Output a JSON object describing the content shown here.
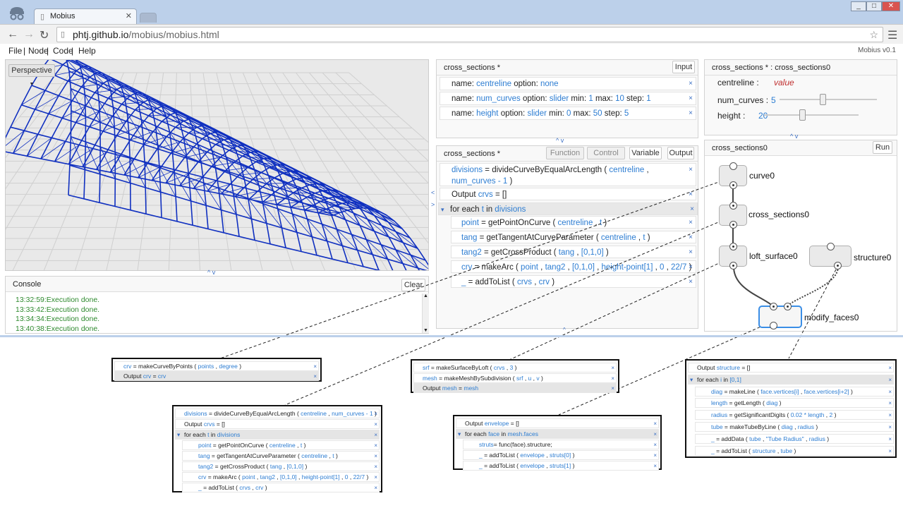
{
  "browser": {
    "tab_title": "Mobius",
    "url_host": "phtj.github.io",
    "url_path": "/mobius/mobius.html"
  },
  "menu": {
    "items": [
      "File",
      "Node",
      "Code",
      "Help"
    ],
    "separator": " | ",
    "version": "Mobius v0.1"
  },
  "viewport": {
    "camera_label": "Perspective"
  },
  "console": {
    "title": "Console",
    "clear_label": "Clear",
    "lines": [
      "13:32:59:Execution done.",
      "13:33:42:Execution done.",
      "13:34:34:Execution done.",
      "13:40:38:Execution done."
    ]
  },
  "input_panel": {
    "title": "cross_sections *",
    "button": "Input",
    "rows": [
      {
        "parts": [
          "name: ",
          "centreline",
          "  option: ",
          "none"
        ]
      },
      {
        "parts": [
          "name: ",
          "num_curves",
          "  option: ",
          "slider",
          "  min: ",
          "1",
          "  max: ",
          "10",
          "  step: ",
          "1"
        ]
      },
      {
        "parts": [
          "name: ",
          "height",
          "  option: ",
          "slider",
          "  min: ",
          "0",
          "  max: ",
          "50",
          "  step: ",
          "5"
        ]
      }
    ]
  },
  "code_panel": {
    "title": "cross_sections *",
    "buttons": [
      "Function",
      "Control",
      "Variable",
      "Output"
    ],
    "rows": [
      {
        "text": [
          "divisions",
          " = divideCurveByEqualArcLength ( ",
          "centreline",
          " ,"
        ]
      },
      {
        "text": [
          "num_curves - 1",
          "   )"
        ]
      },
      {
        "text": [
          "Output ",
          "crvs",
          " = []"
        ]
      },
      {
        "text": [
          "for each ",
          "t",
          " in ",
          "divisions"
        ]
      },
      {
        "text": [
          "point",
          " = getPointOnCurve ( ",
          "centreline",
          " , ",
          "t",
          "   )"
        ]
      },
      {
        "text": [
          "tang",
          " = getTangentAtCurveParameter ( ",
          "centreline",
          " , ",
          "t",
          "   )"
        ]
      },
      {
        "text": [
          "tang2",
          " = getCrossProduct ( ",
          "tang",
          " , ",
          "[0,1,0]",
          "   )"
        ]
      },
      {
        "text": [
          "crv",
          " = makeArc ( ",
          "point",
          " , ",
          "tang2",
          " , ",
          "[0,1,0]",
          " , ",
          "height-point[1]",
          " , ",
          "0",
          " , ",
          "22/7",
          "   )"
        ]
      },
      {
        "text": [
          "_",
          " = addToList ( ",
          "crvs",
          " , ",
          "crv",
          "   )"
        ]
      }
    ]
  },
  "params_panel": {
    "title": "cross_sections * :  cross_sections0",
    "centreline_label": "centreline  :",
    "centreline_value": "value",
    "num_curves_label": "num_curves  :",
    "num_curves_value": "5",
    "num_curves_fraction": 0.44,
    "height_label": "height  :",
    "height_value": "20",
    "height_fraction": 0.4
  },
  "graph_panel": {
    "title": "cross_sections0",
    "run_label": "Run",
    "nodes": [
      "curve0",
      "cross_sections0",
      "loft_surface0",
      "structure0",
      "modify_faces0"
    ]
  },
  "popups": {
    "p1": [
      [
        "crv",
        " = makeCurveByPoints ( ",
        "points",
        " , ",
        "degree",
        "   )"
      ],
      [
        "Output ",
        "crv",
        " = ",
        "crv"
      ]
    ],
    "p2": [
      [
        "divisions",
        " = divideCurveByEqualArcLength ( ",
        "centreline",
        " , ",
        "num_curves - 1",
        "   )"
      ],
      [
        "Output ",
        "crvs",
        " = []"
      ],
      [
        "for each ",
        "t",
        " in ",
        "divisions"
      ],
      [
        "point",
        " = getPointOnCurve ( ",
        "centreline",
        " , ",
        "t",
        "   )"
      ],
      [
        "tang",
        " = getTangentAtCurveParameter ( ",
        "centreline",
        " , ",
        "t",
        "   )"
      ],
      [
        "tang2",
        " = getCrossProduct ( ",
        "tang",
        " , ",
        "[0,1,0]",
        "   )"
      ],
      [
        "crv",
        " = makeArc ( ",
        "point",
        " , ",
        "tang2",
        " , ",
        "[0,1,0]",
        " , ",
        "height-point[1]",
        " , ",
        "0",
        " , ",
        "22/7",
        "   )"
      ],
      [
        "_",
        " = addToList ( ",
        "crvs",
        " , ",
        "crv",
        "   )"
      ]
    ],
    "p3": [
      [
        "srf",
        " = makeSurfaceByLoft ( ",
        "crvs",
        " , ",
        "3",
        "   )"
      ],
      [
        "mesh",
        " = makeMeshBySubdivision ( ",
        "srf",
        " , ",
        "u",
        " , ",
        "v",
        "   )"
      ],
      [
        "Output ",
        "mesh",
        " = ",
        "mesh"
      ]
    ],
    "p4": [
      [
        "Output ",
        "envelope",
        " = []"
      ],
      [
        "for each ",
        "face",
        " in ",
        "mesh.faces"
      ],
      [
        "struts",
        "= func(face).structure;"
      ],
      [
        "_",
        " = addToList ( ",
        "envelope",
        " , ",
        "struts[0]",
        "   )"
      ],
      [
        "_",
        " = addToList ( ",
        "envelope",
        " , ",
        "struts[1]",
        "   )"
      ]
    ],
    "p5": [
      [
        "Output ",
        "structure",
        " = []"
      ],
      [
        "for each ",
        "i",
        " in ",
        "[0,1]"
      ],
      [
        "diag",
        " = makeLine ( ",
        "face.vertices[i]",
        " , ",
        "face.vertices[i+2]",
        "   )"
      ],
      [
        "length",
        " = getLength ( ",
        "diag",
        "   )"
      ],
      [
        "radius",
        " = getSignificantDigits ( ",
        "0.02 * length",
        " , ",
        "2",
        "   )"
      ],
      [
        "tube",
        " = makeTubeByLine ( ",
        "diag",
        " , ",
        "radius",
        "   )"
      ],
      [
        "_",
        " = addData ( ",
        "tube",
        " , ",
        "\"Tube Radius\"",
        " , ",
        "radius",
        "   )"
      ],
      [
        "_",
        " = addToList ( ",
        "structure",
        " , ",
        "tube",
        "   )"
      ]
    ]
  },
  "colors": {
    "accent": "#2d7dd2",
    "console_text": "#2f8a2f",
    "mesh": "#1030c0"
  }
}
